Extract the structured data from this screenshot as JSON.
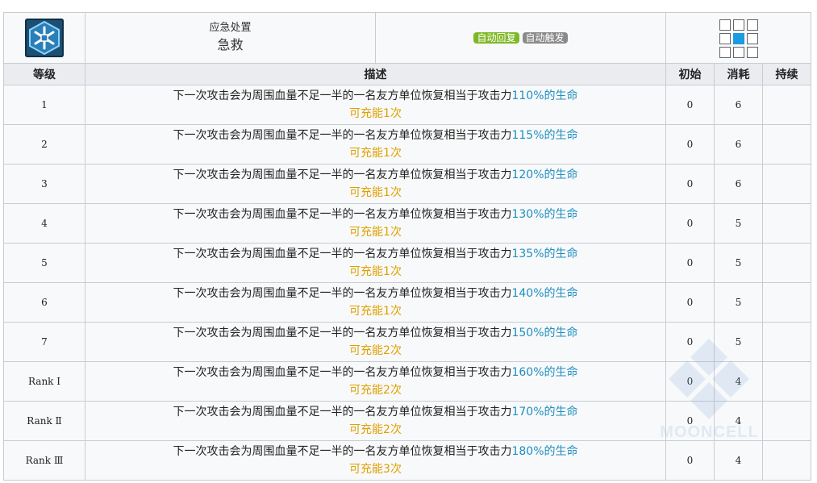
{
  "skill": {
    "kind": "应急处置",
    "name": "急救",
    "tags": [
      "自动回复",
      "自动触发"
    ],
    "icon": "snowflake-medical-icon",
    "tag_colors": {
      "recovery": "#7fb826",
      "trigger": "#8a8a8a"
    }
  },
  "headers": {
    "level": "等级",
    "description": "描述",
    "initial": "初始",
    "cost": "消耗",
    "duration": "持续"
  },
  "rows": [
    {
      "level": "1",
      "desc_main": "下一次攻击会为周围血量不足一半的一名友方单位恢复相当于攻击力",
      "desc_hl": "110%的生命",
      "charge": "可充能1次",
      "initial": "0",
      "cost": "6",
      "duration": ""
    },
    {
      "level": "2",
      "desc_main": "下一次攻击会为周围血量不足一半的一名友方单位恢复相当于攻击力",
      "desc_hl": "115%的生命",
      "charge": "可充能1次",
      "initial": "0",
      "cost": "6",
      "duration": ""
    },
    {
      "level": "3",
      "desc_main": "下一次攻击会为周围血量不足一半的一名友方单位恢复相当于攻击力",
      "desc_hl": "120%的生命",
      "charge": "可充能1次",
      "initial": "0",
      "cost": "6",
      "duration": ""
    },
    {
      "level": "4",
      "desc_main": "下一次攻击会为周围血量不足一半的一名友方单位恢复相当于攻击力",
      "desc_hl": "130%的生命",
      "charge": "可充能1次",
      "initial": "0",
      "cost": "5",
      "duration": ""
    },
    {
      "level": "5",
      "desc_main": "下一次攻击会为周围血量不足一半的一名友方单位恢复相当于攻击力",
      "desc_hl": "135%的生命",
      "charge": "可充能1次",
      "initial": "0",
      "cost": "5",
      "duration": ""
    },
    {
      "level": "6",
      "desc_main": "下一次攻击会为周围血量不足一半的一名友方单位恢复相当于攻击力",
      "desc_hl": "140%的生命",
      "charge": "可充能1次",
      "initial": "0",
      "cost": "5",
      "duration": ""
    },
    {
      "level": "7",
      "desc_main": "下一次攻击会为周围血量不足一半的一名友方单位恢复相当于攻击力",
      "desc_hl": "150%的生命",
      "charge": "可充能2次",
      "initial": "0",
      "cost": "5",
      "duration": ""
    },
    {
      "level": "Rank Ⅰ",
      "desc_main": "下一次攻击会为周围血量不足一半的一名友方单位恢复相当于攻击力",
      "desc_hl": "160%的生命",
      "charge": "可充能2次",
      "initial": "0",
      "cost": "4",
      "duration": ""
    },
    {
      "level": "Rank Ⅱ",
      "desc_main": "下一次攻击会为周围血量不足一半的一名友方单位恢复相当于攻击力",
      "desc_hl": "170%的生命",
      "charge": "可充能2次",
      "initial": "0",
      "cost": "4",
      "duration": ""
    },
    {
      "level": "Rank Ⅲ",
      "desc_main": "下一次攻击会为周围血量不足一半的一名友方单位恢复相当于攻击力",
      "desc_hl": "180%的生命",
      "charge": "可充能3次",
      "initial": "0",
      "cost": "4",
      "duration": ""
    }
  ],
  "range": {
    "icon": "attack-range-grid-icon",
    "self_cell": "center"
  },
  "watermark": {
    "text": "MOONCELL"
  },
  "colors": {
    "highlight": "#1f8fbf",
    "charge": "#e0a000",
    "header_bg": "#eaecf0",
    "cell_bg": "#f8f9fa",
    "border": "#c8ccd1"
  }
}
